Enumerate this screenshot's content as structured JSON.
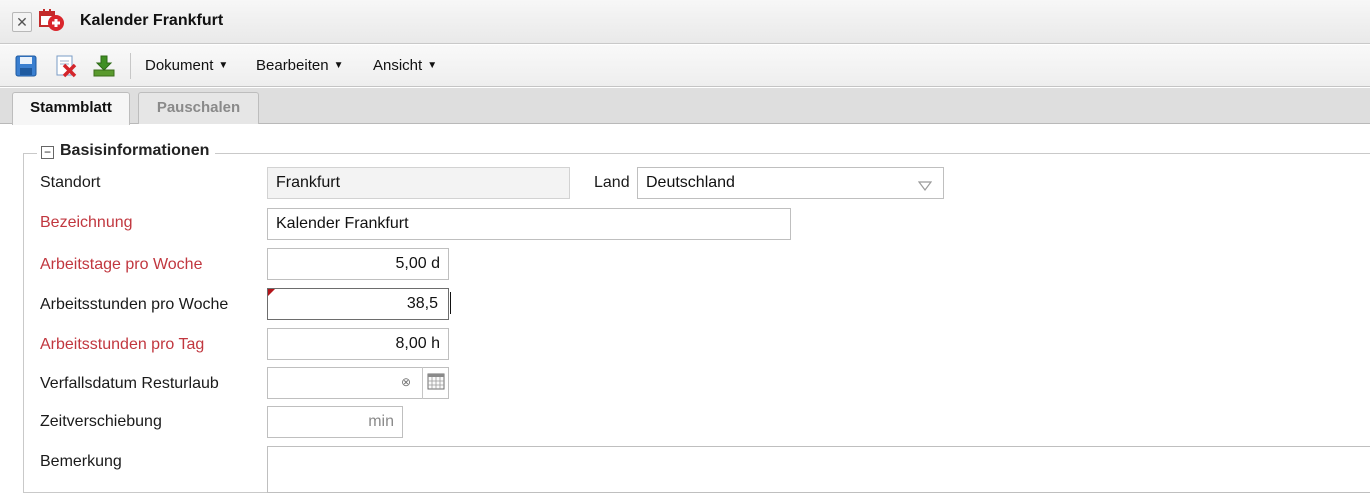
{
  "window": {
    "title": "Kalender Frankfurt",
    "close_icon": "close-icon",
    "app_icon": "calendar-icon"
  },
  "toolbar": {
    "icons": [
      "save-icon",
      "discard-icon",
      "download-icon"
    ],
    "menus": [
      {
        "label": "Dokument"
      },
      {
        "label": "Bearbeiten"
      },
      {
        "label": "Ansicht"
      }
    ]
  },
  "tabs": [
    {
      "label": "Stammblatt",
      "active": true
    },
    {
      "label": "Pauschalen",
      "active": false
    }
  ],
  "section": {
    "title": "Basisinformationen",
    "collapse_symbol": "−"
  },
  "form": {
    "standort": {
      "label": "Standort",
      "value": "Frankfurt"
    },
    "land": {
      "label": "Land",
      "value": "Deutschland"
    },
    "bezeichnung": {
      "label": "Bezeichnung",
      "value": "Kalender Frankfurt"
    },
    "arbeitstage": {
      "label": "Arbeitstage pro Woche",
      "value": "5,00 d"
    },
    "stunden_woche": {
      "label": "Arbeitsstunden pro Woche",
      "value": "38,5"
    },
    "stunden_tag": {
      "label": "Arbeitsstunden pro Tag",
      "value": "8,00 h"
    },
    "verfall": {
      "label": "Verfallsdatum Resturlaub",
      "value": ""
    },
    "zeitverschiebung": {
      "label": "Zeitverschiebung",
      "value": "",
      "unit": "min"
    },
    "bemerkung": {
      "label": "Bemerkung",
      "value": ""
    }
  },
  "colors": {
    "required_label": "#c1373f",
    "dirty_marker": "#b3141a"
  }
}
